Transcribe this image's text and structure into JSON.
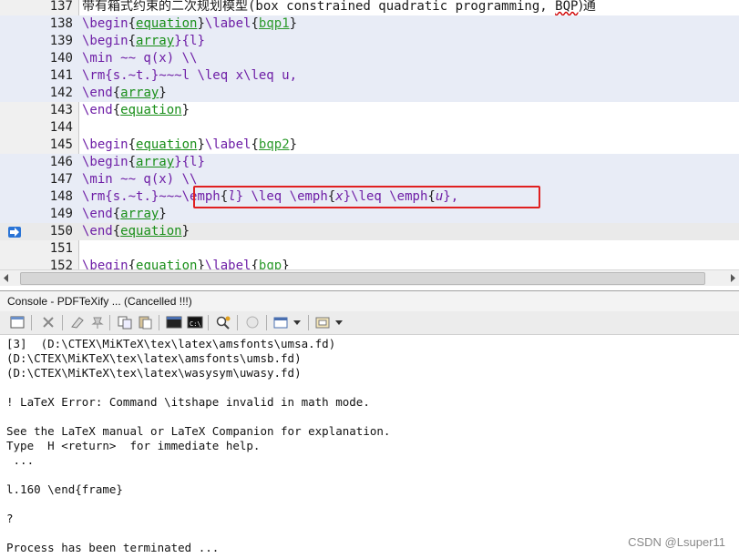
{
  "editor": {
    "lines": [
      {
        "num": "137",
        "parts": [
          {
            "t": "带有箱式约束的二次规划模型",
            "c": "cn"
          },
          {
            "t": "(box constrained quadratic programming, ",
            "c": ""
          },
          {
            "t": "BQP",
            "c": "wavy"
          },
          {
            "t": ")通",
            "c": "cn"
          }
        ]
      },
      {
        "num": "138",
        "parts": [
          {
            "t": "\\begin",
            "c": "kw"
          },
          {
            "t": "{",
            "c": "br"
          },
          {
            "t": "equation",
            "c": "env"
          },
          {
            "t": "}",
            "c": "br"
          },
          {
            "t": "\\label",
            "c": "kw"
          },
          {
            "t": "{",
            "c": "br"
          },
          {
            "t": "bqp1",
            "c": "lbl"
          },
          {
            "t": "}",
            "c": "br"
          }
        ]
      },
      {
        "num": "139",
        "parts": [
          {
            "t": "\\begin",
            "c": "kw"
          },
          {
            "t": "{",
            "c": "br"
          },
          {
            "t": "array",
            "c": "env"
          },
          {
            "t": "}{l}",
            "c": "kw"
          }
        ]
      },
      {
        "num": "140",
        "parts": [
          {
            "t": "\\min ~~ q(x) \\\\",
            "c": "kw"
          }
        ]
      },
      {
        "num": "141",
        "parts": [
          {
            "t": "\\rm",
            "c": "kw"
          },
          {
            "t": "{s.~t.}~~~l \\leq x\\leq u,",
            "c": "kw"
          }
        ]
      },
      {
        "num": "142",
        "parts": [
          {
            "t": "\\end",
            "c": "kw"
          },
          {
            "t": "{",
            "c": "br"
          },
          {
            "t": "array",
            "c": "env"
          },
          {
            "t": "}",
            "c": "br"
          }
        ]
      },
      {
        "num": "143",
        "parts": [
          {
            "t": "\\end",
            "c": "kw"
          },
          {
            "t": "{",
            "c": "br"
          },
          {
            "t": "equation",
            "c": "env"
          },
          {
            "t": "}",
            "c": "br"
          }
        ]
      },
      {
        "num": "144",
        "parts": []
      },
      {
        "num": "145",
        "parts": [
          {
            "t": "\\begin",
            "c": "kw"
          },
          {
            "t": "{",
            "c": "br"
          },
          {
            "t": "equation",
            "c": "env"
          },
          {
            "t": "}",
            "c": "br"
          },
          {
            "t": "\\label",
            "c": "kw"
          },
          {
            "t": "{",
            "c": "br"
          },
          {
            "t": "bqp2",
            "c": "lbl"
          },
          {
            "t": "}",
            "c": "br"
          }
        ]
      },
      {
        "num": "146",
        "parts": [
          {
            "t": "\\begin",
            "c": "kw"
          },
          {
            "t": "{",
            "c": "br"
          },
          {
            "t": "array",
            "c": "env"
          },
          {
            "t": "}{l}",
            "c": "kw"
          }
        ]
      },
      {
        "num": "147",
        "parts": [
          {
            "t": "\\min ~~ q(x) \\\\",
            "c": "kw"
          }
        ]
      },
      {
        "num": "148",
        "parts": [
          {
            "t": "\\rm",
            "c": "kw"
          },
          {
            "t": "{s.~t.}~~~",
            "c": "kw"
          },
          {
            "t": "\\emph",
            "c": "kw"
          },
          {
            "t": "{",
            "c": "br"
          },
          {
            "t": "l",
            "c": "it"
          },
          {
            "t": "} \\leq ",
            "c": "kw"
          },
          {
            "t": "\\emph",
            "c": "kw"
          },
          {
            "t": "{",
            "c": "br"
          },
          {
            "t": "x",
            "c": "it"
          },
          {
            "t": "}\\leq ",
            "c": "kw"
          },
          {
            "t": "\\emph",
            "c": "kw"
          },
          {
            "t": "{",
            "c": "br"
          },
          {
            "t": "u",
            "c": "it"
          },
          {
            "t": "},",
            "c": "kw"
          }
        ]
      },
      {
        "num": "149",
        "parts": [
          {
            "t": "\\end",
            "c": "kw"
          },
          {
            "t": "{",
            "c": "br"
          },
          {
            "t": "array",
            "c": "env"
          },
          {
            "t": "}",
            "c": "br"
          }
        ]
      },
      {
        "num": "150",
        "parts": [
          {
            "t": "\\end",
            "c": "kw"
          },
          {
            "t": "{",
            "c": "br"
          },
          {
            "t": "equation",
            "c": "env"
          },
          {
            "t": "}",
            "c": "br"
          }
        ]
      },
      {
        "num": "151",
        "parts": []
      },
      {
        "num": "152",
        "parts": [
          {
            "t": "\\begin",
            "c": "kw"
          },
          {
            "t": "{",
            "c": "br"
          },
          {
            "t": "equation",
            "c": "env"
          },
          {
            "t": "}",
            "c": "br"
          },
          {
            "t": "\\label",
            "c": "kw"
          },
          {
            "t": "{",
            "c": "br"
          },
          {
            "t": "bqp",
            "c": "lbl"
          },
          {
            "t": "}",
            "c": "br"
          }
        ]
      }
    ],
    "current_line": "150"
  },
  "console": {
    "title": "Console - PDFTeXify ... (Cancelled !!!)",
    "output_lines": [
      "[3]  (D:\\CTEX\\MiKTeX\\tex\\latex\\amsfonts\\umsa.fd)",
      "(D:\\CTEX\\MiKTeX\\tex\\latex\\amsfonts\\umsb.fd)",
      "(D:\\CTEX\\MiKTeX\\tex\\latex\\wasysym\\uwasy.fd)",
      "",
      "! LaTeX Error: Command \\itshape invalid in math mode.",
      "",
      "See the LaTeX manual or LaTeX Companion for explanation.",
      "Type  H <return>  for immediate help.",
      " ...",
      "",
      "l.160 \\end{frame}",
      "",
      "?",
      "",
      "Process has been terminated ..."
    ]
  },
  "watermark": "CSDN @Lsuper11",
  "colors": {
    "error_box": "#e02020",
    "highlight_row": "#e8ecf6",
    "marker": "#2a74d6"
  }
}
